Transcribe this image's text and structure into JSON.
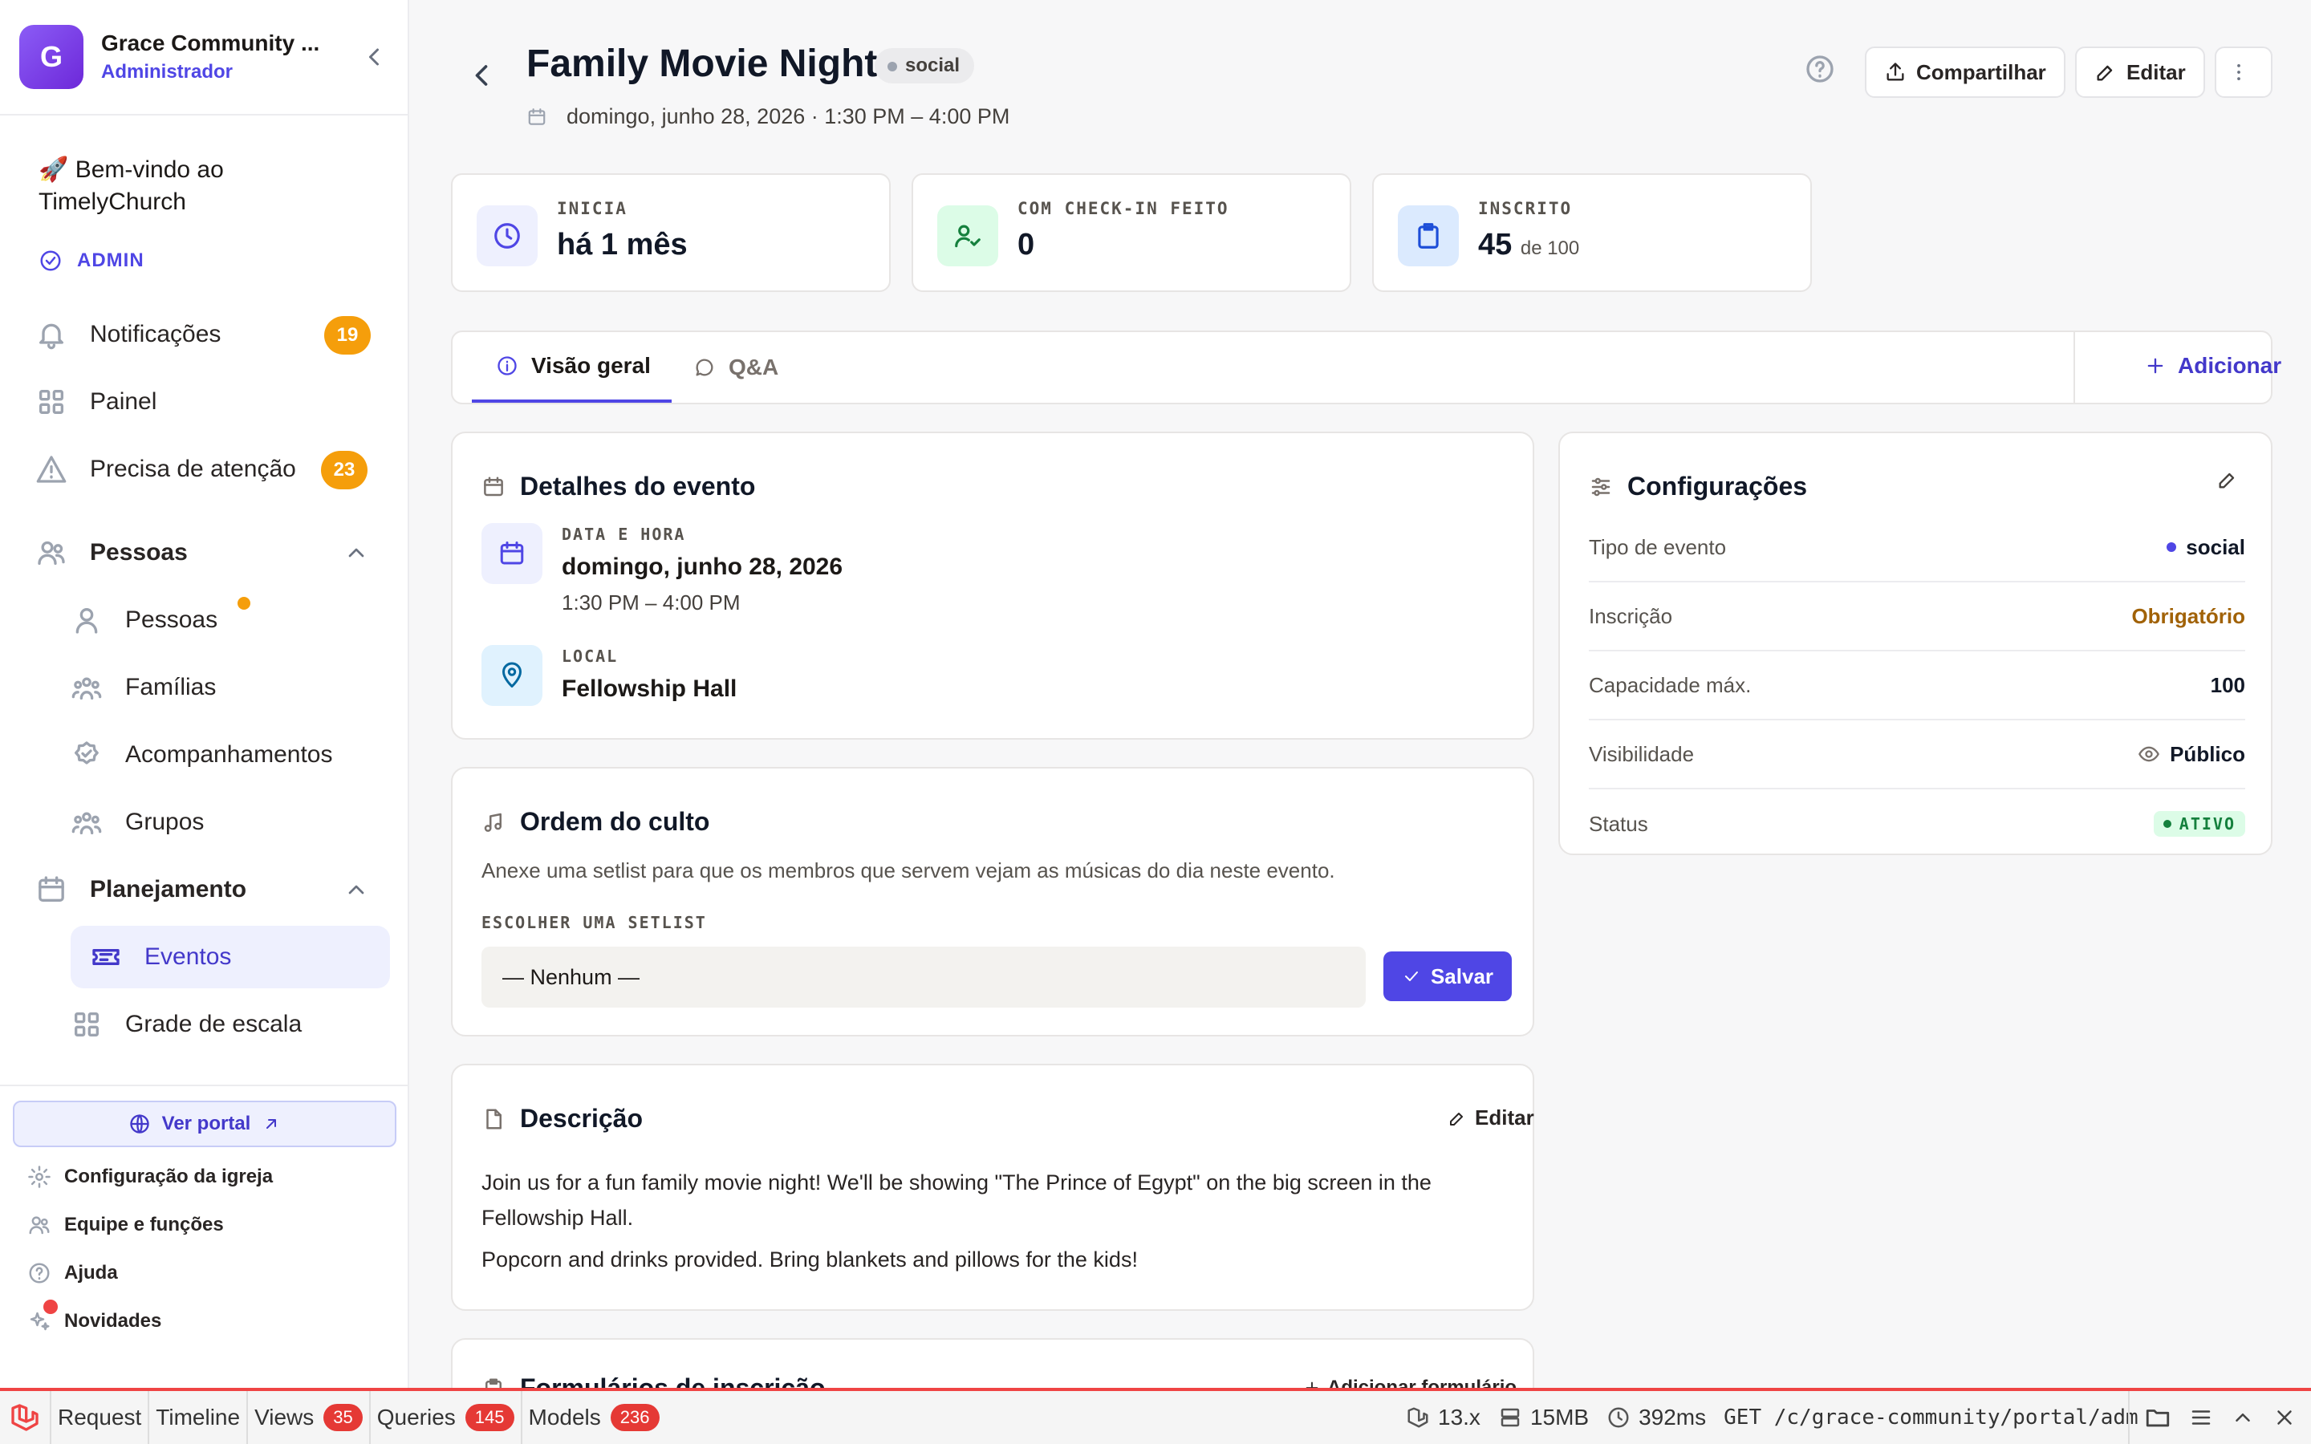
{
  "sidebar": {
    "org_initial": "G",
    "org_name": "Grace Community ...",
    "role": "Administrador",
    "welcome_emoji": "🚀",
    "welcome": "Bem-vindo ao TimelyChurch",
    "section_admin": "ADMIN",
    "notifications": {
      "label": "Notificações",
      "count": "19"
    },
    "dashboard": "Painel",
    "attention": {
      "label": "Precisa de atenção",
      "count": "23"
    },
    "people_group": "Pessoas",
    "people_items": [
      "Pessoas",
      "Famílias",
      "Acompanhamentos",
      "Grupos"
    ],
    "planning_group": "Planejamento",
    "planning_items": [
      "Eventos",
      "Grade de escala"
    ],
    "portal_button": "Ver portal",
    "utilities": [
      "Configuração da igreja",
      "Equipe e funções",
      "Ajuda",
      "Novidades"
    ]
  },
  "header": {
    "title": "Family Movie Night",
    "tag": "social",
    "datetime": "domingo, junho 28, 2026 · 1:30 PM – 4:00 PM",
    "share": "Compartilhar",
    "edit": "Editar"
  },
  "stats": [
    {
      "label": "INICIA",
      "value": "há 1 mês",
      "sub": ""
    },
    {
      "label": "COM CHECK-IN FEITO",
      "value": "0",
      "sub": ""
    },
    {
      "label": "INSCRITO",
      "value": "45",
      "sub": "de 100"
    }
  ],
  "tabs": {
    "overview": "Visão geral",
    "qa": "Q&A",
    "add": "Adicionar"
  },
  "details": {
    "title": "Detalhes do evento",
    "date_label": "DATA E HORA",
    "date": "domingo, junho 28, 2026",
    "time": "1:30 PM – 4:00 PM",
    "location_label": "LOCAL",
    "location": "Fellowship Hall"
  },
  "order": {
    "title": "Ordem do culto",
    "hint": "Anexe uma setlist para que os membros que servem vejam as músicas do dia neste evento.",
    "choose_label": "ESCOLHER UMA SETLIST",
    "selected": "— Nenhum —",
    "save": "Salvar"
  },
  "description": {
    "title": "Descrição",
    "edit": "Editar",
    "p1": "Join us for a fun family movie night! We'll be showing \"The Prince of Egypt\" on the big screen in the Fellowship Hall.",
    "p2": "Popcorn and drinks provided. Bring blankets and pillows for the kids!"
  },
  "forms": {
    "title": "Formulários de inscrição",
    "add": "Adicionar formulário"
  },
  "settings": {
    "title": "Configurações",
    "rows": [
      {
        "key": "Tipo de evento",
        "value": "social"
      },
      {
        "key": "Inscrição",
        "value": "Obrigatório"
      },
      {
        "key": "Capacidade máx.",
        "value": "100"
      },
      {
        "key": "Visibilidade",
        "value": "Público"
      },
      {
        "key": "Status",
        "value": "ATIVO"
      }
    ]
  },
  "debugbar": {
    "items": [
      {
        "label": "Request",
        "count": ""
      },
      {
        "label": "Timeline",
        "count": ""
      },
      {
        "label": "Views",
        "count": "35"
      },
      {
        "label": "Queries",
        "count": "145"
      },
      {
        "label": "Models",
        "count": "236"
      }
    ],
    "version": "13.x",
    "memory": "15MB",
    "time": "392ms",
    "route": "GET /c/grace-community/portal/adm..."
  },
  "colors": {
    "accent": "#4f46e5",
    "badge": "#f59e0b",
    "required": "#a16207",
    "active_green": "#15803d"
  }
}
